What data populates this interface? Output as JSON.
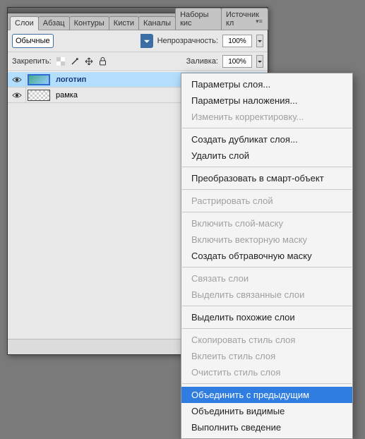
{
  "tabs": [
    "Слои",
    "Абзац",
    "Контуры",
    "Кисти",
    "Каналы",
    "Наборы кис",
    "Источник кл"
  ],
  "active_tab_index": 0,
  "options": {
    "blend_mode": "Обычные",
    "opacity_label": "Непрозрачность:",
    "opacity_value": "100%",
    "lock_label": "Закрепить:",
    "fill_label": "Заливка:",
    "fill_value": "100%"
  },
  "layers": [
    {
      "name": "логотип",
      "selected": true,
      "visible": true,
      "thumb": "logo"
    },
    {
      "name": "рамка",
      "selected": false,
      "visible": true,
      "thumb": "checker"
    }
  ],
  "context_menu": {
    "groups": [
      [
        {
          "label": "Параметры слоя...",
          "enabled": true
        },
        {
          "label": "Параметры наложения...",
          "enabled": true
        },
        {
          "label": "Изменить корректировку...",
          "enabled": false
        }
      ],
      [
        {
          "label": "Создать дубликат слоя...",
          "enabled": true
        },
        {
          "label": "Удалить слой",
          "enabled": true
        }
      ],
      [
        {
          "label": "Преобразовать в смарт-объект",
          "enabled": true
        }
      ],
      [
        {
          "label": "Растрировать слой",
          "enabled": false
        }
      ],
      [
        {
          "label": "Включить слой-маску",
          "enabled": false
        },
        {
          "label": "Включить векторную маску",
          "enabled": false
        },
        {
          "label": "Создать обтравочную маску",
          "enabled": true
        }
      ],
      [
        {
          "label": "Связать слои",
          "enabled": false
        },
        {
          "label": "Выделить связанные слои",
          "enabled": false
        }
      ],
      [
        {
          "label": "Выделить похожие слои",
          "enabled": true
        }
      ],
      [
        {
          "label": "Скопировать стиль слоя",
          "enabled": false
        },
        {
          "label": "Вклеить стиль слоя",
          "enabled": false
        },
        {
          "label": "Очистить стиль слоя",
          "enabled": false
        }
      ],
      [
        {
          "label": "Объединить с предыдущим",
          "enabled": true,
          "highlight": true
        },
        {
          "label": "Объединить видимые",
          "enabled": true
        },
        {
          "label": "Выполнить сведение",
          "enabled": true
        }
      ]
    ]
  }
}
